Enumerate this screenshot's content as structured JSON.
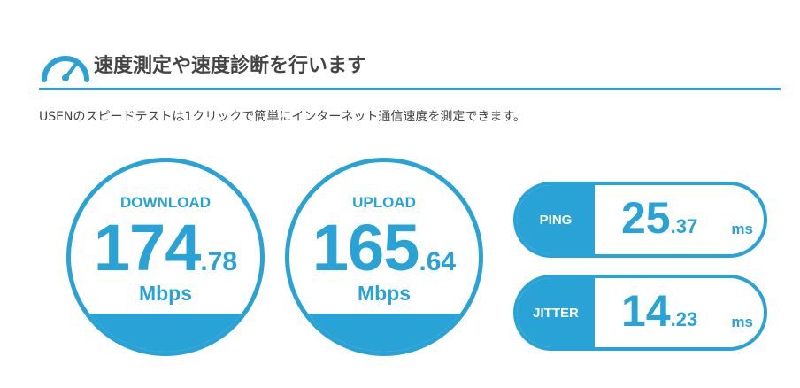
{
  "header": {
    "title": "速度測定や速度診断を行います",
    "icon": "speedometer-icon"
  },
  "subtitle": "USENのスピードテストは1クリックで簡単にインターネット通信速度を測定できます。",
  "colors": {
    "accent": "#29a3d6",
    "text": "#444444",
    "background": "#ffffff"
  },
  "download": {
    "label": "DOWNLOAD",
    "value_int": "174",
    "value_dec": ".78",
    "unit": "Mbps"
  },
  "upload": {
    "label": "UPLOAD",
    "value_int": "165",
    "value_dec": ".64",
    "unit": "Mbps"
  },
  "ping": {
    "label": "PING",
    "value_int": "25",
    "value_dec": ".37",
    "unit": "ms"
  },
  "jitter": {
    "label": "JITTER",
    "value_int": "14",
    "value_dec": ".23",
    "unit": "ms"
  }
}
